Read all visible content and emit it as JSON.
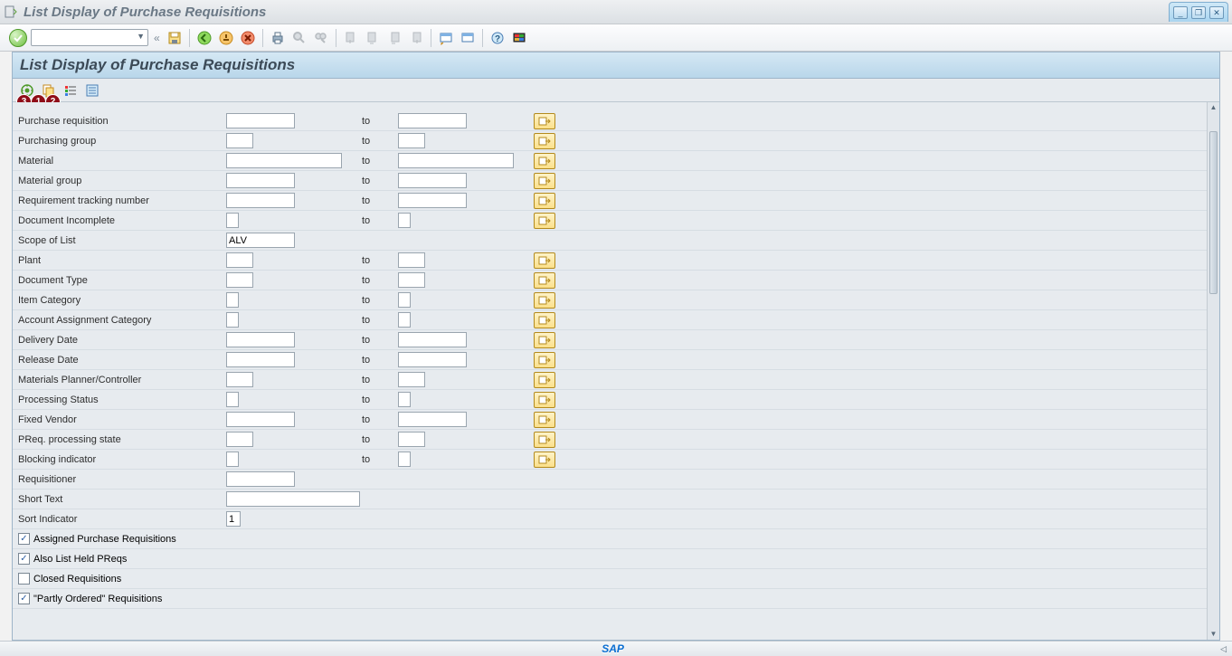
{
  "window": {
    "title": "List Display of Purchase Requisitions"
  },
  "section": {
    "title": "List Display of Purchase Requisitions"
  },
  "annotations": [
    "3",
    "1",
    "2"
  ],
  "labels_to": "to",
  "rows": [
    {
      "label": "Purchase requisition",
      "fromW": "w-med",
      "toW": "w-med",
      "more": true
    },
    {
      "label": "Purchasing group",
      "fromW": "w-sm",
      "toW": "w-sm",
      "more": true
    },
    {
      "label": "Material",
      "fromW": "w-wide",
      "toW": "w-wide",
      "more": true
    },
    {
      "label": "Material group",
      "fromW": "w-med",
      "toW": "w-med",
      "more": true
    },
    {
      "label": "Requirement tracking number",
      "fromW": "w-med",
      "toW": "w-med",
      "more": true
    },
    {
      "label": "Document Incomplete",
      "fromW": "w-tiny",
      "toW": "w-tiny",
      "more": true
    },
    {
      "label": "Scope of List",
      "fromW": "w-med",
      "fromVal": "ALV",
      "toW": null,
      "more": false
    },
    {
      "label": "Plant",
      "fromW": "w-sm",
      "toW": "w-sm",
      "more": true
    },
    {
      "label": "Document Type",
      "fromW": "w-sm",
      "toW": "w-sm",
      "more": true
    },
    {
      "label": "Item Category",
      "fromW": "w-tiny",
      "toW": "w-tiny",
      "more": true
    },
    {
      "label": "Account Assignment Category",
      "fromW": "w-tiny",
      "toW": "w-tiny",
      "more": true
    },
    {
      "label": "Delivery Date",
      "fromW": "w-med",
      "toW": "w-med",
      "more": true
    },
    {
      "label": "Release Date",
      "fromW": "w-med",
      "toW": "w-med",
      "more": true
    },
    {
      "label": "Materials Planner/Controller",
      "fromW": "w-sm",
      "toW": "w-sm",
      "more": true
    },
    {
      "label": "Processing Status",
      "fromW": "w-tiny",
      "toW": "w-tiny",
      "more": true
    },
    {
      "label": "Fixed Vendor",
      "fromW": "w-med",
      "toW": "w-med",
      "more": true
    },
    {
      "label": "PReq. processing state",
      "fromW": "w-sm",
      "toW": "w-sm",
      "more": true
    },
    {
      "label": "Blocking indicator",
      "fromW": "w-tiny",
      "toW": "w-tiny",
      "more": true
    },
    {
      "label": "Requisitioner",
      "fromW": "w-med",
      "toW": null,
      "more": false
    },
    {
      "label": "Short Text",
      "fromW": "w-text",
      "toW": null,
      "more": false
    },
    {
      "label": "Sort Indicator",
      "fromW": "w-num",
      "fromVal": "1",
      "toW": null,
      "more": false
    }
  ],
  "checkboxes": [
    {
      "label": "Assigned Purchase Requisitions",
      "checked": true
    },
    {
      "label": "Also List Held PReqs",
      "checked": true
    },
    {
      "label": "Closed Requisitions",
      "checked": false
    },
    {
      "label": "\"Partly Ordered\" Requisitions",
      "checked": true
    }
  ],
  "footer": {
    "logo": "SAP"
  }
}
